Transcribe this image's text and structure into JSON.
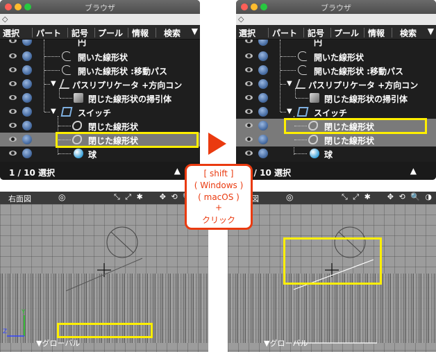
{
  "browser": {
    "title": "ブラウザ",
    "filter_icon": "◇",
    "tabs": [
      "選択",
      "パート",
      "記号",
      "プール",
      "情報",
      "検索"
    ],
    "tab_menu": "▼",
    "items": {
      "partial_top": "円",
      "open_line": "開いた線形状",
      "open_line_move": "開いた線形状 :移動パス",
      "replicator": "パスリプリケータ +方向コン",
      "sweep": "閉じた線形状の掃引体",
      "switch": "スイッチ",
      "closed_line_1": "閉じた線形状",
      "closed_line_2": "閉じた線形状",
      "sphere": "球"
    },
    "status_left": "1 / 10 選択",
    "status_right": "2 / 10 選択",
    "status_arrow": "▲"
  },
  "viewport": {
    "name": "右面図",
    "target_icon": "◎",
    "tools": "⤡ ⤢ ✱",
    "nav": "✥ ⟲ 🔍 ◑",
    "global_label": "▼グローバル",
    "axis_y": "Y",
    "axis_z": "Z"
  },
  "callout": {
    "lines": [
      "[ shift ]",
      "( Windows )",
      "( macOS )",
      "+",
      "クリック"
    ]
  },
  "colors": {
    "highlight": "#ffef00",
    "accent": "#ea3a0f",
    "selected_row": "#7a7a7a"
  },
  "icons": [
    "eye-icon",
    "sphere-icon",
    "line-icon",
    "replicator-icon",
    "sweep-icon",
    "switch-icon",
    "closed-line-icon",
    "arrow-right-icon"
  ]
}
